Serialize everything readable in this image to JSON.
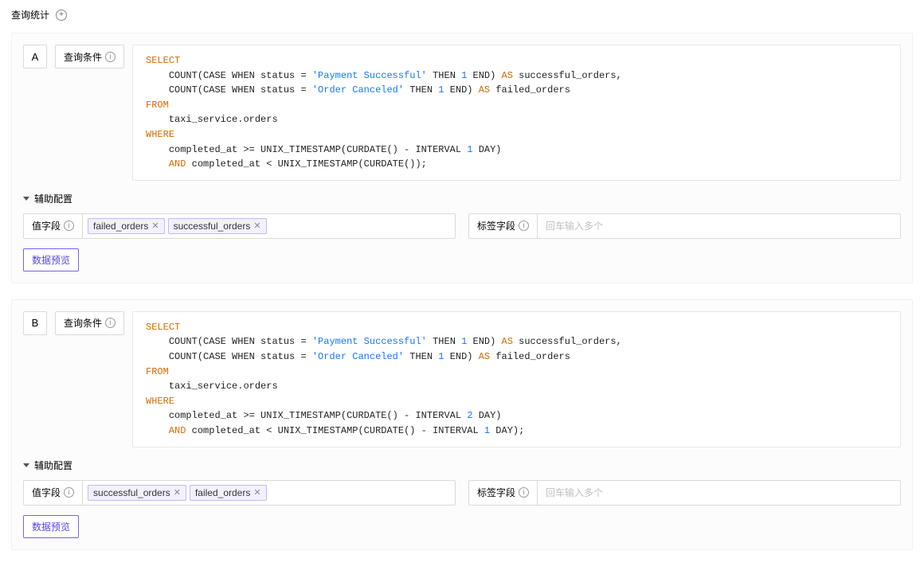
{
  "page": {
    "title": "查询统计"
  },
  "queries": [
    {
      "letter": "A",
      "cond_label": "查询条件",
      "sql_tokens": [
        {
          "t": "kw",
          "v": "SELECT"
        },
        {
          "t": "nl"
        },
        {
          "t": "sp",
          "v": "    "
        },
        {
          "t": "ident",
          "v": "COUNT(CASE WHEN status = "
        },
        {
          "t": "str",
          "v": "'Payment Successful'"
        },
        {
          "t": "ident",
          "v": " THEN "
        },
        {
          "t": "num",
          "v": "1"
        },
        {
          "t": "ident",
          "v": " END) "
        },
        {
          "t": "kw",
          "v": "AS"
        },
        {
          "t": "ident",
          "v": " successful_orders,"
        },
        {
          "t": "nl"
        },
        {
          "t": "sp",
          "v": "    "
        },
        {
          "t": "ident",
          "v": "COUNT(CASE WHEN status = "
        },
        {
          "t": "str",
          "v": "'Order Canceled'"
        },
        {
          "t": "ident",
          "v": " THEN "
        },
        {
          "t": "num",
          "v": "1"
        },
        {
          "t": "ident",
          "v": " END) "
        },
        {
          "t": "kw",
          "v": "AS"
        },
        {
          "t": "ident",
          "v": " failed_orders"
        },
        {
          "t": "nl"
        },
        {
          "t": "kw",
          "v": "FROM"
        },
        {
          "t": "nl"
        },
        {
          "t": "sp",
          "v": "    "
        },
        {
          "t": "ident",
          "v": "taxi_service.orders"
        },
        {
          "t": "nl"
        },
        {
          "t": "kw",
          "v": "WHERE"
        },
        {
          "t": "nl"
        },
        {
          "t": "sp",
          "v": "    "
        },
        {
          "t": "ident",
          "v": "completed_at >= UNIX_TIMESTAMP(CURDATE() - INTERVAL "
        },
        {
          "t": "num",
          "v": "1"
        },
        {
          "t": "ident",
          "v": " DAY)"
        },
        {
          "t": "nl"
        },
        {
          "t": "sp",
          "v": "    "
        },
        {
          "t": "kw",
          "v": "AND"
        },
        {
          "t": "ident",
          "v": " completed_at < UNIX_TIMESTAMP(CURDATE());"
        }
      ],
      "aux_label": "辅助配置",
      "value_field_label": "值字段",
      "value_tags": [
        "failed_orders",
        "successful_orders"
      ],
      "label_field_label": "标签字段",
      "label_placeholder": "回车输入多个",
      "preview_label": "数据预览"
    },
    {
      "letter": "B",
      "cond_label": "查询条件",
      "sql_tokens": [
        {
          "t": "kw",
          "v": "SELECT"
        },
        {
          "t": "nl"
        },
        {
          "t": "sp",
          "v": "    "
        },
        {
          "t": "ident",
          "v": "COUNT(CASE WHEN status = "
        },
        {
          "t": "str",
          "v": "'Payment Successful'"
        },
        {
          "t": "ident",
          "v": " THEN "
        },
        {
          "t": "num",
          "v": "1"
        },
        {
          "t": "ident",
          "v": " END) "
        },
        {
          "t": "kw",
          "v": "AS"
        },
        {
          "t": "ident",
          "v": " successful_orders,"
        },
        {
          "t": "nl"
        },
        {
          "t": "sp",
          "v": "    "
        },
        {
          "t": "ident",
          "v": "COUNT(CASE WHEN status = "
        },
        {
          "t": "str",
          "v": "'Order Canceled'"
        },
        {
          "t": "ident",
          "v": " THEN "
        },
        {
          "t": "num",
          "v": "1"
        },
        {
          "t": "ident",
          "v": " END) "
        },
        {
          "t": "kw",
          "v": "AS"
        },
        {
          "t": "ident",
          "v": " failed_orders"
        },
        {
          "t": "nl"
        },
        {
          "t": "kw",
          "v": "FROM"
        },
        {
          "t": "nl"
        },
        {
          "t": "sp",
          "v": "    "
        },
        {
          "t": "ident",
          "v": "taxi_service.orders"
        },
        {
          "t": "nl"
        },
        {
          "t": "kw",
          "v": "WHERE"
        },
        {
          "t": "nl"
        },
        {
          "t": "sp",
          "v": "    "
        },
        {
          "t": "ident",
          "v": "completed_at >= UNIX_TIMESTAMP(CURDATE() - INTERVAL "
        },
        {
          "t": "num",
          "v": "2"
        },
        {
          "t": "ident",
          "v": " DAY)"
        },
        {
          "t": "nl"
        },
        {
          "t": "sp",
          "v": "    "
        },
        {
          "t": "kw",
          "v": "AND"
        },
        {
          "t": "ident",
          "v": " completed_at < UNIX_TIMESTAMP(CURDATE() - INTERVAL "
        },
        {
          "t": "num",
          "v": "1"
        },
        {
          "t": "ident",
          "v": " DAY);"
        }
      ],
      "aux_label": "辅助配置",
      "value_field_label": "值字段",
      "value_tags": [
        "successful_orders",
        "failed_orders"
      ],
      "label_field_label": "标签字段",
      "label_placeholder": "回车输入多个",
      "preview_label": "数据预览"
    }
  ]
}
